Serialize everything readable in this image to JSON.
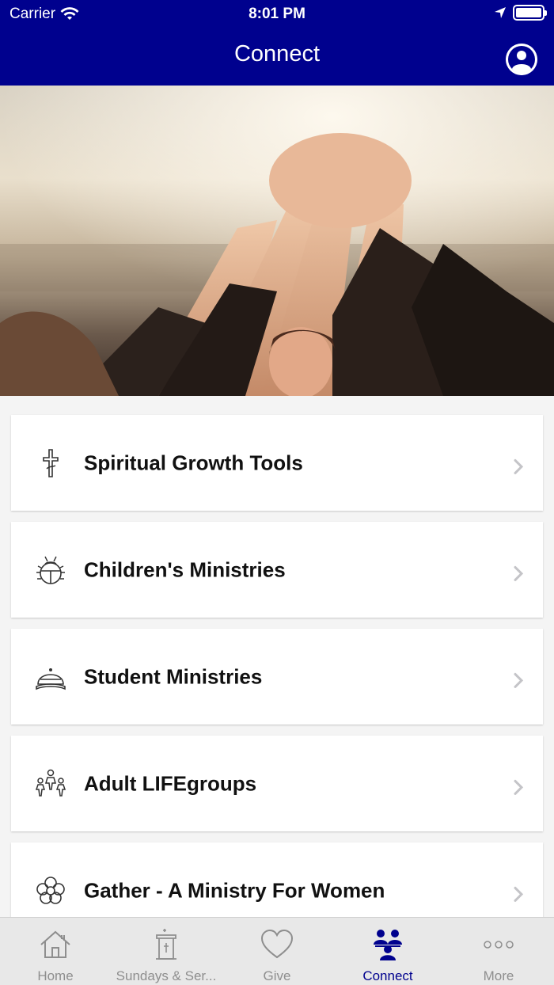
{
  "status_bar": {
    "carrier": "Carrier",
    "time": "8:01 PM"
  },
  "header": {
    "title": "Connect"
  },
  "menu_items": [
    {
      "label": "Spiritual Growth Tools",
      "icon": "cross-icon"
    },
    {
      "label": "Children's Ministries",
      "icon": "ladybug-icon"
    },
    {
      "label": "Student Ministries",
      "icon": "cap-icon"
    },
    {
      "label": "Adult LIFEgroups",
      "icon": "group-icon"
    },
    {
      "label": "Gather - A Ministry For Women",
      "icon": "flower-icon"
    }
  ],
  "tabs": [
    {
      "label": "Home",
      "icon": "home-icon",
      "active": false
    },
    {
      "label": "Sundays & Ser...",
      "icon": "pulpit-icon",
      "active": false
    },
    {
      "label": "Give",
      "icon": "heart-icon",
      "active": false
    },
    {
      "label": "Connect",
      "icon": "people-icon",
      "active": true
    },
    {
      "label": "More",
      "icon": "more-icon",
      "active": false
    }
  ],
  "colors": {
    "brand": "#00018e",
    "tab_inactive": "#8e8e8e"
  }
}
